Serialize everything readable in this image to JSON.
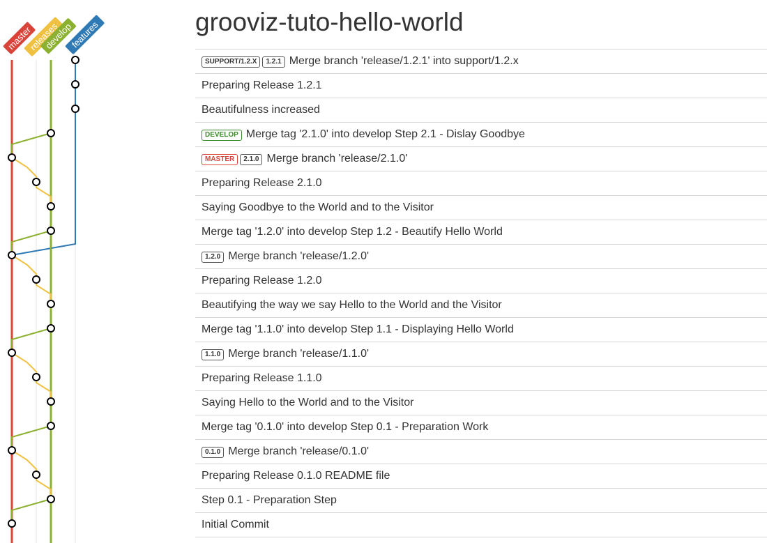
{
  "title": "grooviz-tuto-hello-world",
  "lanes": [
    {
      "name": "master",
      "color": "#d9443a"
    },
    {
      "name": "releases",
      "color": "#f0c040"
    },
    {
      "name": "develop",
      "color": "#8cb030"
    },
    {
      "name": "features",
      "color": "#2f7ab5"
    }
  ],
  "commits": [
    {
      "lane": 3,
      "badges": [
        {
          "text": "SUPPORT/1.2.X",
          "kind": "plain"
        },
        {
          "text": "1.2.1",
          "kind": "plain"
        }
      ],
      "message": "Merge branch 'release/1.2.1' into support/1.2.x"
    },
    {
      "lane": 3,
      "badges": [],
      "message": "Preparing Release 1.2.1"
    },
    {
      "lane": 3,
      "badges": [],
      "message": "Beautifulness increased"
    },
    {
      "lane": 2,
      "badges": [
        {
          "text": "DEVELOP",
          "kind": "develop"
        }
      ],
      "message": "Merge tag '2.1.0' into develop Step 2.1 - Dislay Goodbye"
    },
    {
      "lane": 0,
      "badges": [
        {
          "text": "MASTER",
          "kind": "master"
        },
        {
          "text": "2.1.0",
          "kind": "plain"
        }
      ],
      "message": "Merge branch 'release/2.1.0'"
    },
    {
      "lane": 1,
      "badges": [],
      "message": "Preparing Release 2.1.0"
    },
    {
      "lane": 2,
      "badges": [],
      "message": "Saying Goodbye to the World and to the Visitor"
    },
    {
      "lane": 2,
      "badges": [],
      "message": "Merge tag '1.2.0' into develop Step 1.2 - Beautify Hello World"
    },
    {
      "lane": 0,
      "badges": [
        {
          "text": "1.2.0",
          "kind": "plain"
        }
      ],
      "message": "Merge branch 'release/1.2.0'"
    },
    {
      "lane": 1,
      "badges": [],
      "message": "Preparing Release 1.2.0"
    },
    {
      "lane": 2,
      "badges": [],
      "message": "Beautifying the way we say Hello to the World and the Visitor"
    },
    {
      "lane": 2,
      "badges": [],
      "message": "Merge tag '1.1.0' into develop Step 1.1 - Displaying Hello World"
    },
    {
      "lane": 0,
      "badges": [
        {
          "text": "1.1.0",
          "kind": "plain"
        }
      ],
      "message": "Merge branch 'release/1.1.0'"
    },
    {
      "lane": 1,
      "badges": [],
      "message": "Preparing Release 1.1.0"
    },
    {
      "lane": 2,
      "badges": [],
      "message": "Saying Hello to the World and to the Visitor"
    },
    {
      "lane": 2,
      "badges": [],
      "message": "Merge tag '0.1.0' into develop Step 0.1 - Preparation Work"
    },
    {
      "lane": 0,
      "badges": [
        {
          "text": "0.1.0",
          "kind": "plain"
        }
      ],
      "message": "Merge branch 'release/0.1.0'"
    },
    {
      "lane": 1,
      "badges": [],
      "message": "Preparing Release 0.1.0 README file"
    },
    {
      "lane": 2,
      "badges": [],
      "message": "Step 0.1 - Preparation Step"
    },
    {
      "lane": 0,
      "badges": [],
      "message": "Initial Commit"
    }
  ],
  "edges": [
    {
      "from": 0,
      "to": 1,
      "lane": 3
    },
    {
      "from": 1,
      "to": 2,
      "lane": 3
    },
    {
      "from": 2,
      "to": 8,
      "lane": 3
    },
    {
      "from": 3,
      "to": 4,
      "lane": 2
    },
    {
      "from": 3,
      "to": 6,
      "lane": 2
    },
    {
      "from": 4,
      "to": 5,
      "lane": 1
    },
    {
      "from": 4,
      "to": 8,
      "lane": 0
    },
    {
      "from": 5,
      "to": 6,
      "lane": 1
    },
    {
      "from": 6,
      "to": 7,
      "lane": 2
    },
    {
      "from": 7,
      "to": 8,
      "lane": 2
    },
    {
      "from": 7,
      "to": 10,
      "lane": 2
    },
    {
      "from": 8,
      "to": 9,
      "lane": 1
    },
    {
      "from": 8,
      "to": 12,
      "lane": 0
    },
    {
      "from": 9,
      "to": 10,
      "lane": 1
    },
    {
      "from": 10,
      "to": 11,
      "lane": 2
    },
    {
      "from": 11,
      "to": 12,
      "lane": 2
    },
    {
      "from": 11,
      "to": 14,
      "lane": 2
    },
    {
      "from": 12,
      "to": 13,
      "lane": 1
    },
    {
      "from": 12,
      "to": 16,
      "lane": 0
    },
    {
      "from": 13,
      "to": 14,
      "lane": 1
    },
    {
      "from": 14,
      "to": 15,
      "lane": 2
    },
    {
      "from": 15,
      "to": 16,
      "lane": 2
    },
    {
      "from": 15,
      "to": 18,
      "lane": 2
    },
    {
      "from": 16,
      "to": 17,
      "lane": 1
    },
    {
      "from": 16,
      "to": 19,
      "lane": 0
    },
    {
      "from": 17,
      "to": 18,
      "lane": 1
    },
    {
      "from": 18,
      "to": 19,
      "lane": 2
    }
  ]
}
